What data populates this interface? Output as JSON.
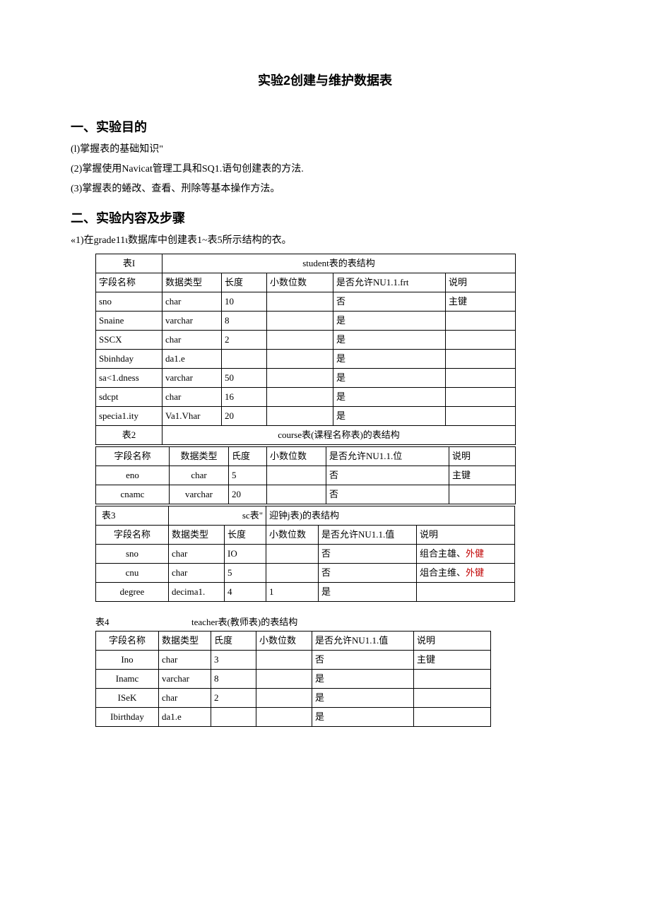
{
  "title": "实验2创建与维护数据表",
  "section1": {
    "heading": "一、实验目的",
    "p1": "(l)掌握表的基础知识\"",
    "p2": "(2)掌握使用Navicat管理工具和SQ1.语句创建表的方法.",
    "p3": "(3)掌握表的蜷改、查看、刑除等基本操作方法。"
  },
  "section2": {
    "heading": "二、实验内容及步骤",
    "intro": "«1)在grade11ι数据库中创建表1~表5所示结构的衣。"
  },
  "headers": {
    "field": "字段名称",
    "dtype": "数据类型",
    "len": "长度",
    "len2": "氏度",
    "dec": "小数位数",
    "null_frt": "是否允许NU1.1.frt",
    "null_wei": "是否允许NU1.1.位",
    "null_zhi": "是否允许NU1.1.值",
    "desc": "说明"
  },
  "table1": {
    "caption_left": "表I",
    "caption_center": "student表的表结构",
    "rows": [
      {
        "f": "sno",
        "t": "char",
        "l": "10",
        "d": "",
        "n": "否",
        "s": "主键"
      },
      {
        "f": "Snaine",
        "t": "varchar",
        "l": "8",
        "d": "",
        "n": "是",
        "s": ""
      },
      {
        "f": "SSCX",
        "t": "char",
        "l": "2",
        "d": "",
        "n": "是",
        "s": ""
      },
      {
        "f": "Sbinhday",
        "t": "da1.e",
        "l": "",
        "d": "",
        "n": "是",
        "s": ""
      },
      {
        "f": "sa<1.dness",
        "t": "varchar",
        "l": "50",
        "d": "",
        "n": "是",
        "s": ""
      },
      {
        "f": "sdcpt",
        "t": "char",
        "l": "16",
        "d": "",
        "n": "是",
        "s": ""
      },
      {
        "f": "specia1.ity",
        "t": "Va1.Vhar",
        "l": "20",
        "d": "",
        "n": "是",
        "s": ""
      }
    ]
  },
  "table2": {
    "caption_left": "表2",
    "caption_center": "course表(课程名称表)的表结构",
    "rows": [
      {
        "f": "eno",
        "t": "char",
        "l": "5",
        "d": "",
        "n": "否",
        "s": "主键"
      },
      {
        "f": "cnamc",
        "t": "varchar",
        "l": "20",
        "d": "",
        "n": "否",
        "s": ""
      }
    ]
  },
  "table3": {
    "caption_left": "表3",
    "caption_mid": "sc表\"",
    "caption_right": "迎钟j表)的表结构",
    "rows": [
      {
        "f": "sno",
        "t": "char",
        "l": "IO",
        "d": "",
        "n": "否",
        "s1": "组合主雄、",
        "s2": "外健"
      },
      {
        "f": "cnu",
        "t": "char",
        "l": "5",
        "d": "",
        "n": "否",
        "s1": "俎合主维、",
        "s2": "外键"
      },
      {
        "f": "degree",
        "t": "decima1.",
        "l": "4",
        "d": "1",
        "n": "是",
        "s1": "",
        "s2": ""
      }
    ]
  },
  "table4": {
    "caption": "表4",
    "caption_center": "teacher表(教师表)的表结构",
    "rows": [
      {
        "f": "Ino",
        "t": "char",
        "l": "3",
        "d": "",
        "n": "否",
        "s": "主键"
      },
      {
        "f": "Inamc",
        "t": "varchar",
        "l": "8",
        "d": "",
        "n": "是",
        "s": ""
      },
      {
        "f": "ISeK",
        "t": "char",
        "l": "2",
        "d": "",
        "n": "是",
        "s": ""
      },
      {
        "f": "Ibirthday",
        "t": "da1.e",
        "l": "",
        "d": "",
        "n": "是",
        "s": ""
      }
    ]
  }
}
